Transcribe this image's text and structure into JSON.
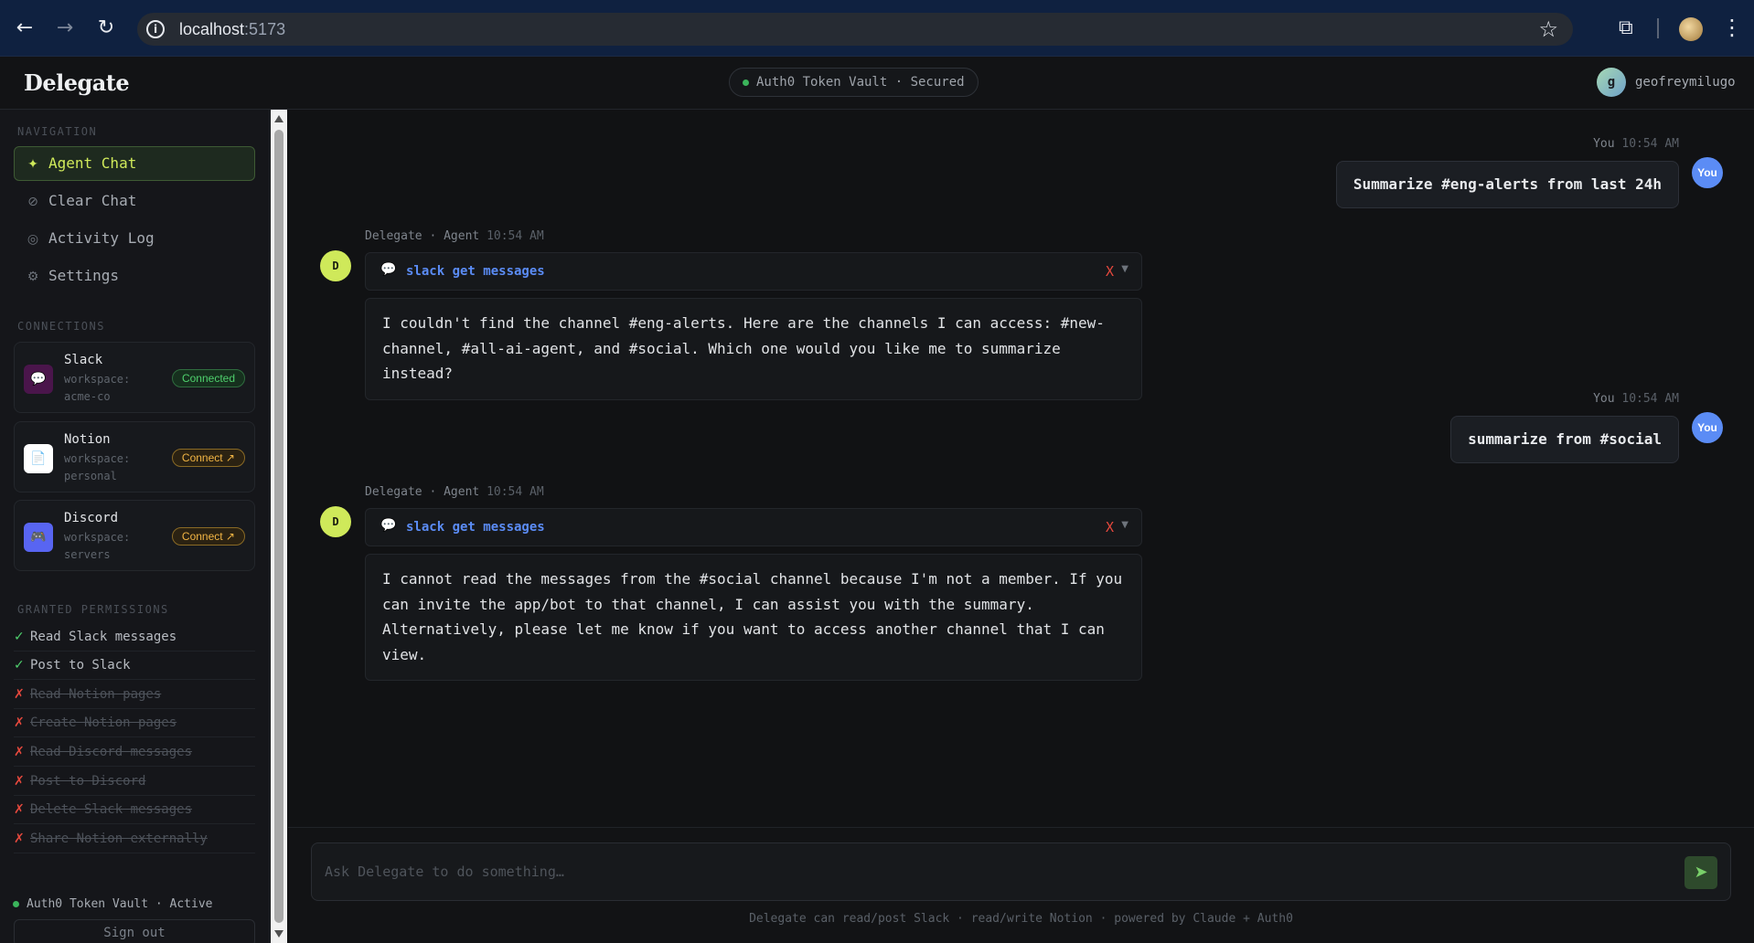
{
  "browser": {
    "url_host": "localhost",
    "url_port": ":5173",
    "back_icon": "arrow-left-icon",
    "forward_icon": "arrow-right-icon",
    "reload_icon": "reload-icon",
    "info_icon": "info-icon",
    "bookmark_icon": "star-icon",
    "extensions_icon": "puzzle-icon",
    "menu_icon": "kebab-icon"
  },
  "header": {
    "brand": "Delegate",
    "vault_status": "Auth0 Token Vault · Secured",
    "user_initial": "g",
    "user_name": "geofreymilugo"
  },
  "sidebar": {
    "nav_title": "NAVIGATION",
    "nav": [
      {
        "label": "Agent Chat",
        "icon": "✦",
        "active": true
      },
      {
        "label": "Clear Chat",
        "icon": "⊘",
        "active": false
      },
      {
        "label": "Activity Log",
        "icon": "◎",
        "active": false
      },
      {
        "label": "Settings",
        "icon": "⚙",
        "active": false
      }
    ],
    "connections_title": "CONNECTIONS",
    "connections": [
      {
        "name": "Slack",
        "desc": "workspace: acme-co",
        "status": "Connected",
        "icon": "💬",
        "color": "#4a154b"
      },
      {
        "name": "Notion",
        "desc": "workspace: personal",
        "status": "Connect ↗",
        "icon": "📄",
        "color": "#ffffff"
      },
      {
        "name": "Discord",
        "desc": "workspace: servers",
        "status": "Connect ↗",
        "icon": "🎮",
        "color": "#5865f2"
      }
    ],
    "permissions_title": "GRANTED PERMISSIONS",
    "permissions": [
      {
        "label": "Read Slack messages",
        "granted": true
      },
      {
        "label": "Post to Slack",
        "granted": true
      },
      {
        "label": "Read Notion pages",
        "granted": false
      },
      {
        "label": "Create Notion pages",
        "granted": false
      },
      {
        "label": "Read Discord messages",
        "granted": false
      },
      {
        "label": "Post to Discord",
        "granted": false
      },
      {
        "label": "Delete Slack messages",
        "granted": false
      },
      {
        "label": "Share Notion externally",
        "granted": false
      }
    ],
    "footer_status": "Auth0 Token Vault · Active",
    "sign_out": "Sign out"
  },
  "chat": {
    "messages": [
      {
        "role": "user",
        "who": "You",
        "time": "10:54 AM",
        "avatar": "You",
        "text": "Summarize #eng-alerts from last 24h"
      },
      {
        "role": "agent",
        "who": "Delegate · Agent",
        "time": "10:54 AM",
        "avatar": "D",
        "tool": "slack get messages",
        "tool_status": "X",
        "text": "I couldn't find the channel #eng-alerts. Here are the channels I can access: #new-channel, #all-ai-agent, and #social. Which one would you like me to summarize instead?"
      },
      {
        "role": "user",
        "who": "You",
        "time": "10:54 AM",
        "avatar": "You",
        "text": "summarize from #social"
      },
      {
        "role": "agent",
        "who": "Delegate · Agent",
        "time": "10:54 AM",
        "avatar": "D",
        "tool": "slack get messages",
        "tool_status": "X",
        "text": "I cannot read the messages from the #social channel because I'm not a member. If you can invite the app/bot to that channel, I can assist you with the summary. Alternatively, please let me know if you want to access another channel that I can view."
      }
    ]
  },
  "composer": {
    "placeholder": "Ask Delegate to do something…",
    "send_icon": "send-icon",
    "footnote": "Delegate can read/post Slack · read/write Notion · powered by Claude + Auth0"
  }
}
